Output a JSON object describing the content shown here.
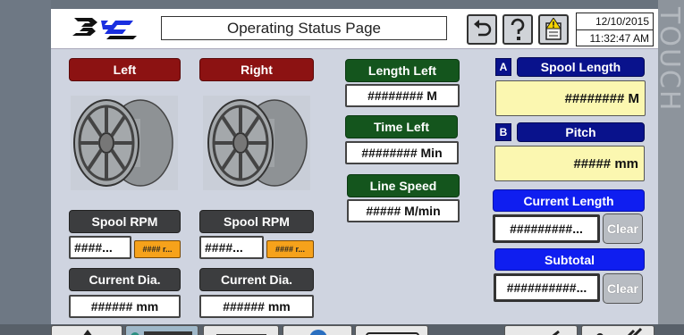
{
  "bezel": {
    "brand_word": "TOUCH"
  },
  "header": {
    "title": "Operating Status Page",
    "date": "12/10/2015",
    "time": "11:32:47 AM"
  },
  "left": {
    "label": "Left",
    "spool_rpm_label": "Spool RPM",
    "spool_rpm_value": "####...",
    "spool_rpm_tag": "#### r...",
    "current_dia_label": "Current Dia.",
    "current_dia_value": "###### mm"
  },
  "right": {
    "label": "Right",
    "spool_rpm_label": "Spool RPM",
    "spool_rpm_value": "####...",
    "spool_rpm_tag": "#### r...",
    "current_dia_label": "Current Dia.",
    "current_dia_value": "###### mm"
  },
  "middle": {
    "length_left_label": "Length Left",
    "length_left_value": "######## M",
    "time_left_label": "Time Left",
    "time_left_value": "######## Min",
    "line_speed_label": "Line Speed",
    "line_speed_value": "##### M/min"
  },
  "rightpanel": {
    "a_badge": "A",
    "spool_length_label": "Spool Length",
    "spool_length_value": "######## M",
    "b_badge": "B",
    "pitch_label": "Pitch",
    "pitch_value": "##### mm",
    "current_length_label": "Current Length",
    "current_length_value": "#########...",
    "clear1": "Clear",
    "subtotal_label": "Subtotal",
    "subtotal_value": "##########...",
    "clear2": "Clear"
  },
  "colors": {
    "red_label": "#8c1212",
    "green_label": "#14551d",
    "dark_label": "#3c3d3f",
    "navy_label": "#09128c",
    "blue_label": "#0f1ef0",
    "yellow_field": "#fbf7b0",
    "orange_tag": "#f6a21b"
  }
}
